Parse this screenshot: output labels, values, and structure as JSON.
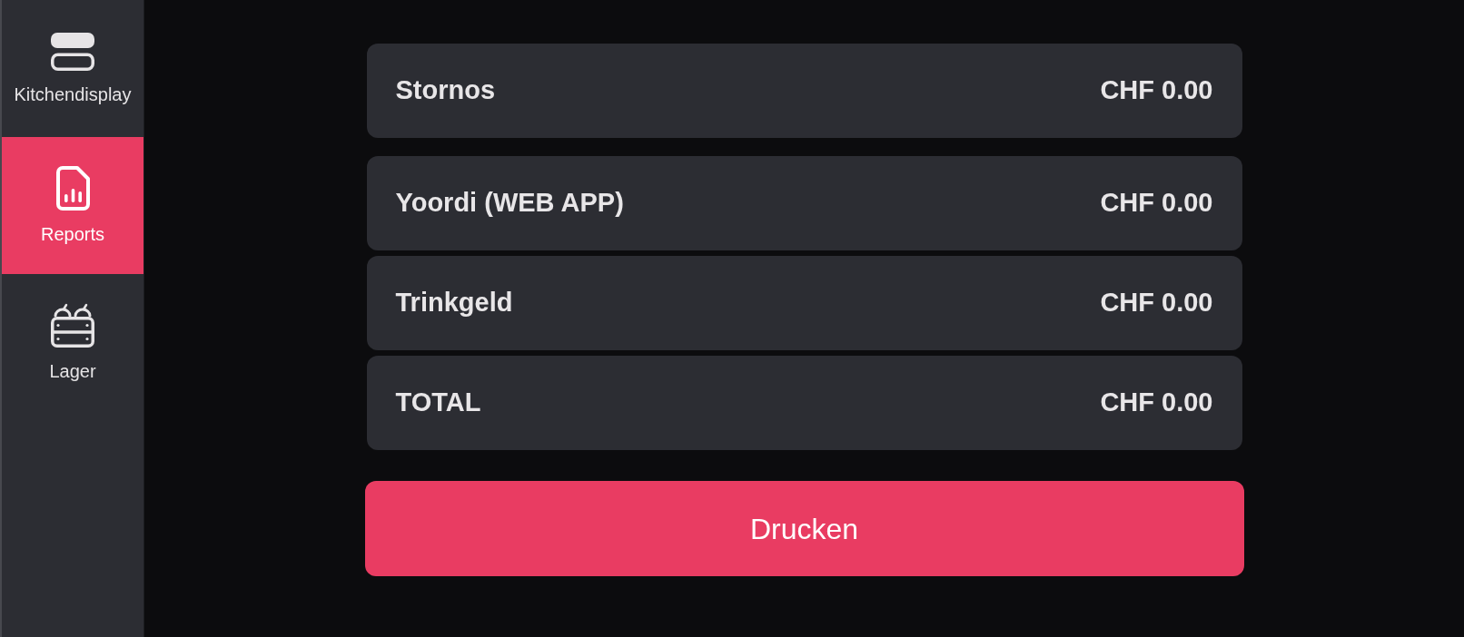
{
  "sidebar": {
    "items": [
      {
        "label": "Kitchendisplay",
        "selected": false
      },
      {
        "label": "Reports",
        "selected": true
      },
      {
        "label": "Lager",
        "selected": false
      }
    ]
  },
  "report": {
    "sections": [
      {
        "rows": [
          {
            "label": "Stornos",
            "amount": "CHF 0.00"
          }
        ]
      },
      {
        "rows": [
          {
            "label": "Yoordi (WEB APP)",
            "amount": "CHF 0.00"
          },
          {
            "label": "Trinkgeld",
            "amount": "CHF 0.00"
          },
          {
            "label": "TOTAL",
            "amount": "CHF 0.00"
          }
        ]
      }
    ]
  },
  "print_button": {
    "label": "Drucken"
  }
}
